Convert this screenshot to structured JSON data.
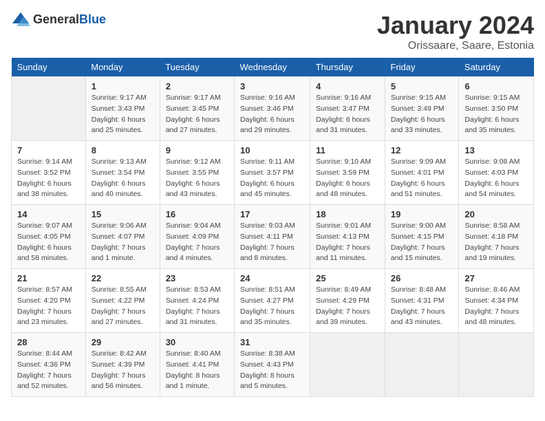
{
  "header": {
    "logo_general": "General",
    "logo_blue": "Blue",
    "title": "January 2024",
    "subtitle": "Orissaare, Saare, Estonia"
  },
  "columns": [
    "Sunday",
    "Monday",
    "Tuesday",
    "Wednesday",
    "Thursday",
    "Friday",
    "Saturday"
  ],
  "weeks": [
    {
      "days": [
        {
          "num": "",
          "info": ""
        },
        {
          "num": "1",
          "info": "Sunrise: 9:17 AM\nSunset: 3:43 PM\nDaylight: 6 hours and 25 minutes."
        },
        {
          "num": "2",
          "info": "Sunrise: 9:17 AM\nSunset: 3:45 PM\nDaylight: 6 hours and 27 minutes."
        },
        {
          "num": "3",
          "info": "Sunrise: 9:16 AM\nSunset: 3:46 PM\nDaylight: 6 hours and 29 minutes."
        },
        {
          "num": "4",
          "info": "Sunrise: 9:16 AM\nSunset: 3:47 PM\nDaylight: 6 hours and 31 minutes."
        },
        {
          "num": "5",
          "info": "Sunrise: 9:15 AM\nSunset: 3:49 PM\nDaylight: 6 hours and 33 minutes."
        },
        {
          "num": "6",
          "info": "Sunrise: 9:15 AM\nSunset: 3:50 PM\nDaylight: 6 hours and 35 minutes."
        }
      ]
    },
    {
      "days": [
        {
          "num": "7",
          "info": "Sunrise: 9:14 AM\nSunset: 3:52 PM\nDaylight: 6 hours and 38 minutes."
        },
        {
          "num": "8",
          "info": "Sunrise: 9:13 AM\nSunset: 3:54 PM\nDaylight: 6 hours and 40 minutes."
        },
        {
          "num": "9",
          "info": "Sunrise: 9:12 AM\nSunset: 3:55 PM\nDaylight: 6 hours and 43 minutes."
        },
        {
          "num": "10",
          "info": "Sunrise: 9:11 AM\nSunset: 3:57 PM\nDaylight: 6 hours and 45 minutes."
        },
        {
          "num": "11",
          "info": "Sunrise: 9:10 AM\nSunset: 3:59 PM\nDaylight: 6 hours and 48 minutes."
        },
        {
          "num": "12",
          "info": "Sunrise: 9:09 AM\nSunset: 4:01 PM\nDaylight: 6 hours and 51 minutes."
        },
        {
          "num": "13",
          "info": "Sunrise: 9:08 AM\nSunset: 4:03 PM\nDaylight: 6 hours and 54 minutes."
        }
      ]
    },
    {
      "days": [
        {
          "num": "14",
          "info": "Sunrise: 9:07 AM\nSunset: 4:05 PM\nDaylight: 6 hours and 58 minutes."
        },
        {
          "num": "15",
          "info": "Sunrise: 9:06 AM\nSunset: 4:07 PM\nDaylight: 7 hours and 1 minute."
        },
        {
          "num": "16",
          "info": "Sunrise: 9:04 AM\nSunset: 4:09 PM\nDaylight: 7 hours and 4 minutes."
        },
        {
          "num": "17",
          "info": "Sunrise: 9:03 AM\nSunset: 4:11 PM\nDaylight: 7 hours and 8 minutes."
        },
        {
          "num": "18",
          "info": "Sunrise: 9:01 AM\nSunset: 4:13 PM\nDaylight: 7 hours and 11 minutes."
        },
        {
          "num": "19",
          "info": "Sunrise: 9:00 AM\nSunset: 4:15 PM\nDaylight: 7 hours and 15 minutes."
        },
        {
          "num": "20",
          "info": "Sunrise: 8:58 AM\nSunset: 4:18 PM\nDaylight: 7 hours and 19 minutes."
        }
      ]
    },
    {
      "days": [
        {
          "num": "21",
          "info": "Sunrise: 8:57 AM\nSunset: 4:20 PM\nDaylight: 7 hours and 23 minutes."
        },
        {
          "num": "22",
          "info": "Sunrise: 8:55 AM\nSunset: 4:22 PM\nDaylight: 7 hours and 27 minutes."
        },
        {
          "num": "23",
          "info": "Sunrise: 8:53 AM\nSunset: 4:24 PM\nDaylight: 7 hours and 31 minutes."
        },
        {
          "num": "24",
          "info": "Sunrise: 8:51 AM\nSunset: 4:27 PM\nDaylight: 7 hours and 35 minutes."
        },
        {
          "num": "25",
          "info": "Sunrise: 8:49 AM\nSunset: 4:29 PM\nDaylight: 7 hours and 39 minutes."
        },
        {
          "num": "26",
          "info": "Sunrise: 8:48 AM\nSunset: 4:31 PM\nDaylight: 7 hours and 43 minutes."
        },
        {
          "num": "27",
          "info": "Sunrise: 8:46 AM\nSunset: 4:34 PM\nDaylight: 7 hours and 48 minutes."
        }
      ]
    },
    {
      "days": [
        {
          "num": "28",
          "info": "Sunrise: 8:44 AM\nSunset: 4:36 PM\nDaylight: 7 hours and 52 minutes."
        },
        {
          "num": "29",
          "info": "Sunrise: 8:42 AM\nSunset: 4:39 PM\nDaylight: 7 hours and 56 minutes."
        },
        {
          "num": "30",
          "info": "Sunrise: 8:40 AM\nSunset: 4:41 PM\nDaylight: 8 hours and 1 minute."
        },
        {
          "num": "31",
          "info": "Sunrise: 8:38 AM\nSunset: 4:43 PM\nDaylight: 8 hours and 5 minutes."
        },
        {
          "num": "",
          "info": ""
        },
        {
          "num": "",
          "info": ""
        },
        {
          "num": "",
          "info": ""
        }
      ]
    }
  ]
}
